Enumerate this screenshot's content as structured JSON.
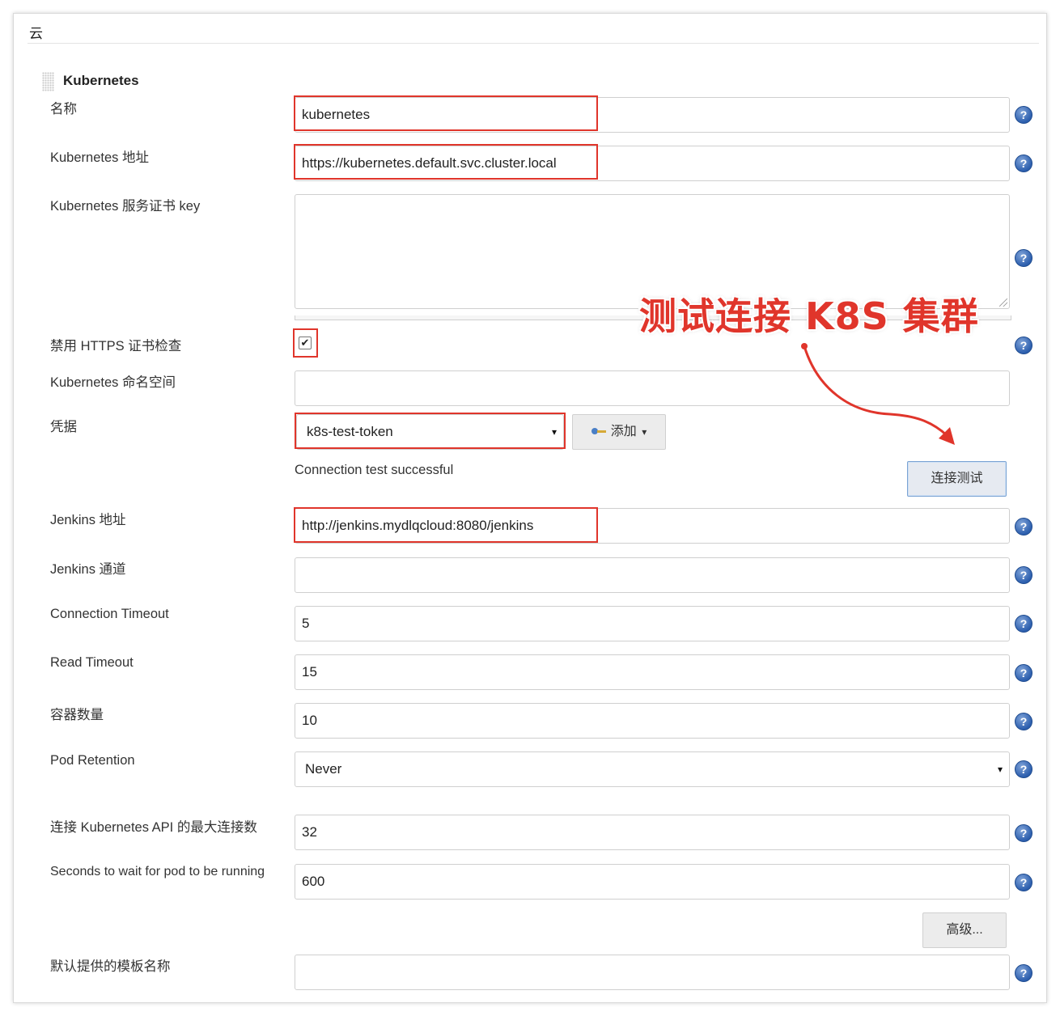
{
  "section": {
    "title": "云"
  },
  "cloud": {
    "name": "Kubernetes"
  },
  "fields": {
    "name": {
      "label": "名称",
      "value": "kubernetes"
    },
    "k8s_url": {
      "label": "Kubernetes 地址",
      "value": "https://kubernetes.default.svc.cluster.local"
    },
    "server_cert": {
      "label": "Kubernetes 服务证书 key",
      "value": ""
    },
    "skip_tls": {
      "label": "禁用 HTTPS 证书检查",
      "checked": true,
      "check_glyph": "✔"
    },
    "namespace": {
      "label": "Kubernetes 命名空间",
      "value": ""
    },
    "credentials": {
      "label": "凭据",
      "selected": "k8s-test-token",
      "add_button": "添加",
      "add_caret": "▾"
    },
    "connection_status": "Connection test successful",
    "test_button": "连接测试",
    "jenkins_url": {
      "label": "Jenkins 地址",
      "value": "http://jenkins.mydlqcloud:8080/jenkins"
    },
    "jenkins_tunnel": {
      "label": "Jenkins 通道",
      "value": ""
    },
    "connection_timeout": {
      "label": "Connection Timeout",
      "value": "5"
    },
    "read_timeout": {
      "label": "Read Timeout",
      "value": "15"
    },
    "container_cap": {
      "label": "容器数量",
      "value": "10"
    },
    "pod_retention": {
      "label": "Pod Retention",
      "selected": "Never"
    },
    "max_connections": {
      "label": "连接 Kubernetes API 的最大连接数",
      "value": "32"
    },
    "wait_for_pod": {
      "label": "Seconds to wait for pod to be running",
      "value": "600"
    },
    "advanced_button": "高级...",
    "default_template": {
      "label": "默认提供的模板名称",
      "value": ""
    }
  },
  "help_glyph": "?",
  "select_caret": "▾",
  "annotation": {
    "text": "测试连接 K8S 集群",
    "color": "#e0352b"
  },
  "icons": {
    "help": "help-icon",
    "credentials": "key-icon",
    "drag": "drag-handle-icon"
  },
  "colors": {
    "highlight": "#e0352b",
    "help": "#2d5fae"
  }
}
